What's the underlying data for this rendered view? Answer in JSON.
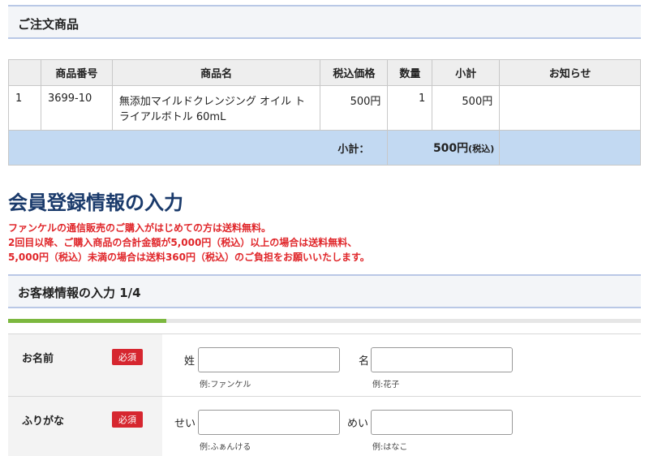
{
  "order_section": {
    "title": "ご注文商品"
  },
  "order_table": {
    "headers": [
      "",
      "商品番号",
      "商品名",
      "税込価格",
      "数量",
      "小計",
      "お知らせ"
    ],
    "rows": [
      {
        "index": "1",
        "code": "3699-10",
        "name": "無添加マイルドクレンジング オイル トライアルボトル 60mL",
        "price": "500円",
        "qty": "1",
        "subtotal": "500円",
        "notice": ""
      }
    ],
    "subtotal_label": "小計：",
    "subtotal_value": "500円",
    "subtotal_tax": "(税込)"
  },
  "registration": {
    "heading": "会員登録情報の入力",
    "notice_lines": [
      "ファンケルの通信販売のご購入がはじめての方は送料無料。",
      "2回目以降、ご購入商品の合計金額が5,000円（税込）以上の場合は送料無料、",
      "5,000円（税込）未満の場合は送料360円（税込）のご負担をお願いいたします。"
    ]
  },
  "customer_section": {
    "title": "お客様情報の入力 1/4"
  },
  "progress": {
    "fraction": 0.25,
    "fill_color": "#7cb83f"
  },
  "form": {
    "name_row": {
      "label": "お名前",
      "required": "必須",
      "last_label": "姓",
      "last_example": "例:ファンケル",
      "first_label": "名",
      "first_example": "例:花子"
    },
    "kana_row": {
      "label": "ふりがな",
      "required": "必須",
      "last_label": "せい",
      "last_example": "例:ふぁんける",
      "first_label": "めい",
      "first_example": "例:はなこ"
    }
  },
  "colors": {
    "heading": "#1a3a6b",
    "notice": "#e0262a",
    "required_badge": "#d6262f",
    "subtotal_bg": "#c2d9f2"
  }
}
